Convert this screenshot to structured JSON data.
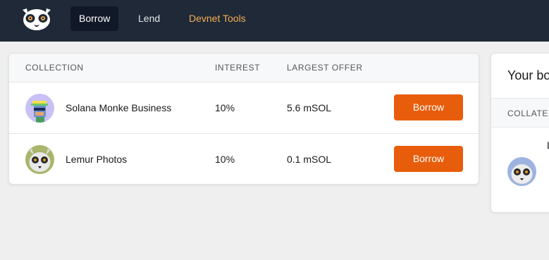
{
  "nav": {
    "items": [
      {
        "label": "Borrow",
        "active": true
      },
      {
        "label": "Lend",
        "active": false
      },
      {
        "label": "Devnet Tools",
        "active": false
      }
    ],
    "logo_icon": "lemur-face-icon"
  },
  "table": {
    "headers": [
      "COLLECTION",
      "INTEREST",
      "LARGEST OFFER"
    ],
    "rows": [
      {
        "avatar_icon": "monke-avatar-icon",
        "collection": "Solana Monke Business",
        "interest": "10%",
        "largest_offer": "5.6 mSOL",
        "action": "Borrow"
      },
      {
        "avatar_icon": "lemur-photo-avatar-icon",
        "collection": "Lemur Photos",
        "interest": "10%",
        "largest_offer": "0.1 mSOL",
        "action": "Borrow"
      }
    ]
  },
  "side_panel": {
    "title": "Your bo",
    "header": "COLLATEI",
    "truncated_text": "L"
  },
  "colors": {
    "nav_bg": "#1f2937",
    "accent": "#e85d0c",
    "tools_link": "#f6ad55"
  }
}
